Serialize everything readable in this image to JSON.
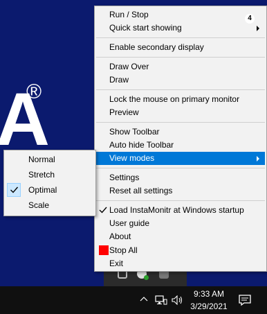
{
  "desktop": {
    "brand_letter": "A",
    "brand_reg": "®"
  },
  "menu": {
    "items": [
      {
        "label": "Run / Stop"
      },
      {
        "label": "Quick start showing"
      },
      {
        "label": "Enable secondary display"
      },
      {
        "label": "Draw Over"
      },
      {
        "label": "Draw"
      },
      {
        "label": "Lock the mouse on primary monitor"
      },
      {
        "label": "Preview"
      },
      {
        "label": "Show Toolbar"
      },
      {
        "label": "Auto hide Toolbar"
      },
      {
        "label": "View modes"
      },
      {
        "label": "Settings"
      },
      {
        "label": "Reset all settings"
      },
      {
        "label": "Load InstaMonitr at Windows startup"
      },
      {
        "label": "User guide"
      },
      {
        "label": "About"
      },
      {
        "label": "Stop All"
      },
      {
        "label": "Exit"
      }
    ]
  },
  "submenu": {
    "items": [
      {
        "label": "Normal"
      },
      {
        "label": "Stretch"
      },
      {
        "label": "Optimal",
        "checked": true
      },
      {
        "label": "Scale"
      }
    ]
  },
  "taskbar": {
    "time": "9:33 AM",
    "date": "3/29/2021",
    "notification_count": "4"
  },
  "colors": {
    "highlight": "#0078d7",
    "desktop": "#0b1a6e",
    "stop_all": "#ff0000"
  }
}
